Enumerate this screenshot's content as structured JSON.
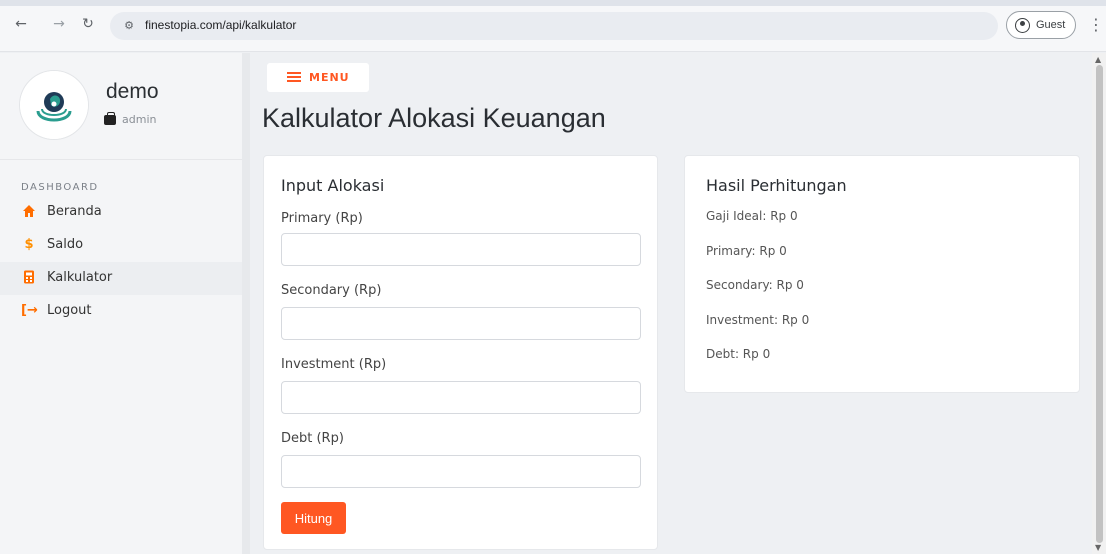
{
  "browser": {
    "url": "finestopia.com/api/kalkulator",
    "profile_label": "Guest",
    "icons": [
      "back-arrow-icon",
      "forward-arrow-icon",
      "reload-icon",
      "site-settings-icon",
      "guest-profile-icon",
      "more-vert-icon"
    ]
  },
  "sidebar": {
    "user_name": "demo",
    "user_role": "admin",
    "section_label": "DASHBOARD",
    "items": [
      {
        "label": "Beranda",
        "icon": "home-icon",
        "icon_color": "#ff6d00"
      },
      {
        "label": "Saldo",
        "icon": "dollar-icon",
        "icon_color": "#ff8f00"
      },
      {
        "label": "Kalkulator",
        "icon": "calculator-icon",
        "icon_color": "#ff6d00",
        "active": true
      },
      {
        "label": "Logout",
        "icon": "logout-icon",
        "icon_color": "#ff6d00"
      }
    ]
  },
  "header": {
    "menu_label": "MENU",
    "page_title": "Kalkulator Alokasi Keuangan"
  },
  "input_card": {
    "title": "Input Alokasi",
    "fields": [
      {
        "label": "Primary (Rp)",
        "value": ""
      },
      {
        "label": "Secondary (Rp)",
        "value": ""
      },
      {
        "label": "Investment (Rp)",
        "value": ""
      },
      {
        "label": "Debt (Rp)",
        "value": ""
      }
    ],
    "submit_label": "Hitung"
  },
  "result_card": {
    "title": "Hasil Perhitungan",
    "lines": [
      "Gaji Ideal: Rp 0",
      "Primary: Rp 0",
      "Secondary: Rp 0",
      "Investment: Rp 0",
      "Debt: Rp 0"
    ]
  },
  "colors": {
    "accent": "#ff5722",
    "sidebar_bg": "#f4f5f7",
    "page_bg": "#eef0f3"
  }
}
